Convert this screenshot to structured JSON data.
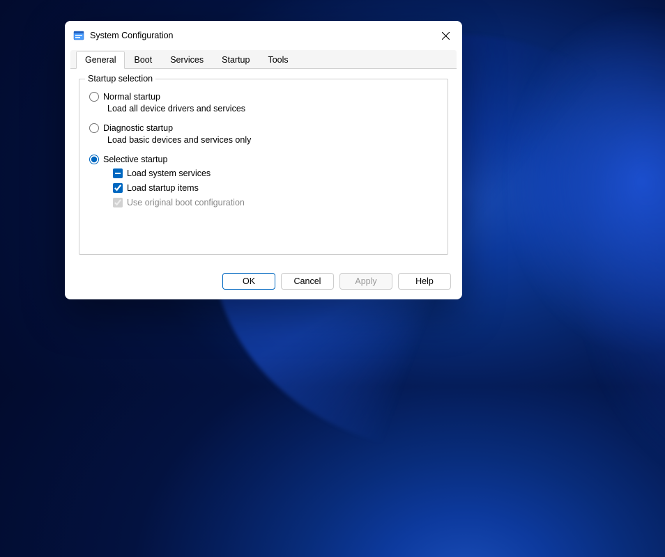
{
  "titlebar": {
    "title": "System Configuration"
  },
  "tabs": [
    {
      "label": "General",
      "active": true
    },
    {
      "label": "Boot",
      "active": false
    },
    {
      "label": "Services",
      "active": false
    },
    {
      "label": "Startup",
      "active": false
    },
    {
      "label": "Tools",
      "active": false
    }
  ],
  "groupbox": {
    "legend": "Startup selection",
    "options": [
      {
        "label": "Normal startup",
        "desc": "Load all device drivers and services",
        "selected": false
      },
      {
        "label": "Diagnostic startup",
        "desc": "Load basic devices and services only",
        "selected": false
      },
      {
        "label": "Selective startup",
        "desc": "",
        "selected": true,
        "checks": [
          {
            "label": "Load system services",
            "state": "indeterminate",
            "disabled": false
          },
          {
            "label": "Load startup items",
            "state": "checked",
            "disabled": false
          },
          {
            "label": "Use original boot configuration",
            "state": "checked",
            "disabled": true
          }
        ]
      }
    ]
  },
  "buttons": {
    "ok": "OK",
    "cancel": "Cancel",
    "apply": "Apply",
    "help": "Help"
  }
}
